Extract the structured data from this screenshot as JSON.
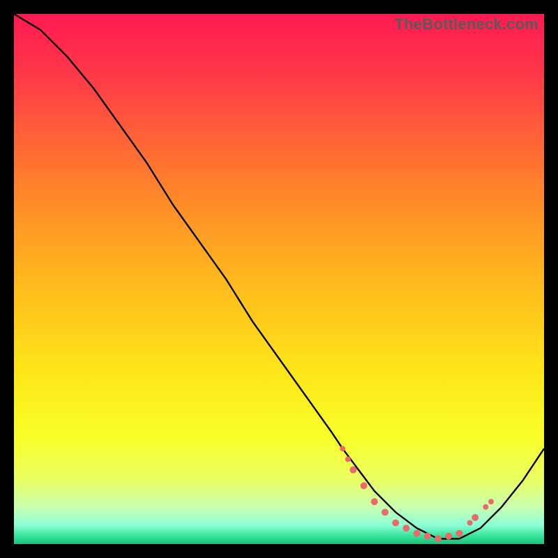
{
  "watermark": "TheBottleneck.com",
  "chart_data": {
    "type": "line",
    "title": "",
    "xlabel": "",
    "ylabel": "",
    "xlim": [
      0,
      100
    ],
    "ylim": [
      0,
      100
    ],
    "grid": false,
    "legend": false,
    "background_gradient": {
      "stops": [
        {
          "offset": 0.0,
          "color": "#ff1a52"
        },
        {
          "offset": 0.12,
          "color": "#ff3a48"
        },
        {
          "offset": 0.3,
          "color": "#ff7a2e"
        },
        {
          "offset": 0.5,
          "color": "#ffb81d"
        },
        {
          "offset": 0.68,
          "color": "#ffe71a"
        },
        {
          "offset": 0.8,
          "color": "#f8ff2a"
        },
        {
          "offset": 0.88,
          "color": "#eaff63"
        },
        {
          "offset": 0.93,
          "color": "#c9ffb0"
        },
        {
          "offset": 0.965,
          "color": "#8bffd7"
        },
        {
          "offset": 0.985,
          "color": "#35e39a"
        },
        {
          "offset": 1.0,
          "color": "#1dbf7a"
        }
      ]
    },
    "series": [
      {
        "name": "curve",
        "color": "#000000",
        "x": [
          0,
          5,
          10,
          15,
          20,
          25,
          30,
          35,
          40,
          45,
          50,
          55,
          60,
          62,
          65,
          68,
          72,
          76,
          80,
          84,
          88,
          92,
          96,
          100
        ],
        "y": [
          100,
          97,
          92,
          86,
          79,
          72,
          64,
          57,
          50,
          42,
          35,
          28,
          21,
          18,
          14,
          10,
          6,
          3,
          1,
          1,
          3,
          7,
          12,
          18
        ]
      }
    ],
    "markers": {
      "color": "#e96a6a",
      "points": [
        {
          "x": 62,
          "y": 18,
          "r": 4
        },
        {
          "x": 63,
          "y": 16,
          "r": 4
        },
        {
          "x": 64,
          "y": 14,
          "r": 5
        },
        {
          "x": 66,
          "y": 11,
          "r": 5
        },
        {
          "x": 68,
          "y": 8,
          "r": 5
        },
        {
          "x": 70,
          "y": 6,
          "r": 5
        },
        {
          "x": 72,
          "y": 4,
          "r": 5
        },
        {
          "x": 74,
          "y": 3,
          "r": 5
        },
        {
          "x": 76,
          "y": 2,
          "r": 5
        },
        {
          "x": 78,
          "y": 1.5,
          "r": 5
        },
        {
          "x": 80,
          "y": 1,
          "r": 5
        },
        {
          "x": 82,
          "y": 1.5,
          "r": 5
        },
        {
          "x": 84,
          "y": 2,
          "r": 5
        },
        {
          "x": 86,
          "y": 4,
          "r": 4
        },
        {
          "x": 87,
          "y": 5,
          "r": 5
        },
        {
          "x": 89,
          "y": 7,
          "r": 4
        },
        {
          "x": 90,
          "y": 8,
          "r": 4
        }
      ]
    }
  }
}
